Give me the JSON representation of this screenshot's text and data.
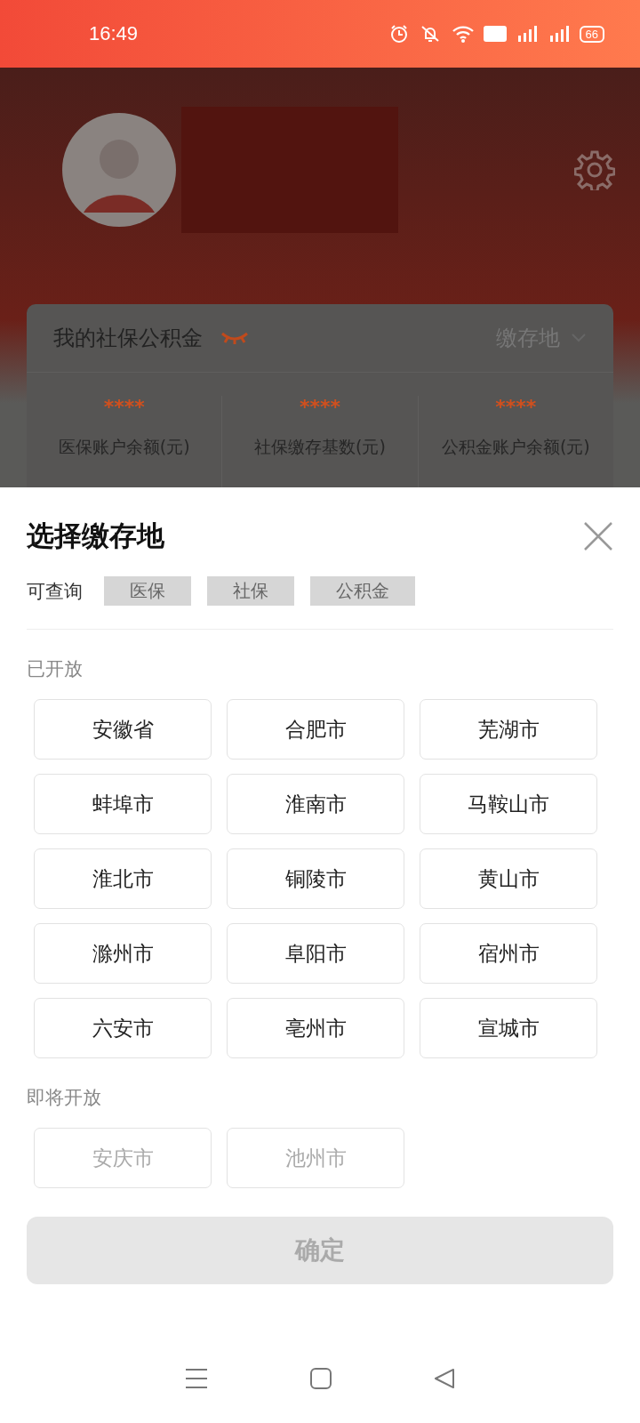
{
  "status_bar": {
    "time": "16:49",
    "battery": "66"
  },
  "card": {
    "title": "我的社保公积金",
    "location_label": "缴存地",
    "stats": [
      {
        "value": "****",
        "label": "医保账户余额(元)"
      },
      {
        "value": "****",
        "label": "社保缴存基数(元)"
      },
      {
        "value": "****",
        "label": "公积金账户余额(元)"
      }
    ]
  },
  "sheet": {
    "title": "选择缴存地",
    "query_label": "可查询",
    "tags": [
      {
        "label": "医保",
        "disabled": true
      },
      {
        "label": "社保",
        "disabled": true
      },
      {
        "label": "公积金",
        "disabled": true
      }
    ],
    "sections": [
      {
        "title": "已开放",
        "cities": [
          {
            "label": "安徽省",
            "disabled": false,
            "selected": false
          },
          {
            "label": "合肥市",
            "disabled": false,
            "selected": false
          },
          {
            "label": "芜湖市",
            "disabled": false,
            "selected": false
          },
          {
            "label": "蚌埠市",
            "disabled": false,
            "selected": false
          },
          {
            "label": "淮南市",
            "disabled": false,
            "selected": false
          },
          {
            "label": "马鞍山市",
            "disabled": false,
            "selected": false
          },
          {
            "label": "淮北市",
            "disabled": false,
            "selected": false
          },
          {
            "label": "铜陵市",
            "disabled": false,
            "selected": false
          },
          {
            "label": "黄山市",
            "disabled": false,
            "selected": false
          },
          {
            "label": "滁州市",
            "disabled": false,
            "selected": false
          },
          {
            "label": "阜阳市",
            "disabled": false,
            "selected": false
          },
          {
            "label": "宿州市",
            "disabled": false,
            "selected": false
          },
          {
            "label": "六安市",
            "disabled": false,
            "selected": false
          },
          {
            "label": "亳州市",
            "disabled": false,
            "selected": false
          },
          {
            "label": "宣城市",
            "disabled": false,
            "selected": false
          }
        ]
      },
      {
        "title": "即将开放",
        "cities": [
          {
            "label": "安庆市",
            "disabled": true,
            "selected": false
          },
          {
            "label": "池州市",
            "disabled": true,
            "selected": false
          }
        ]
      }
    ],
    "confirm": {
      "label": "确定",
      "disabled": true
    }
  }
}
